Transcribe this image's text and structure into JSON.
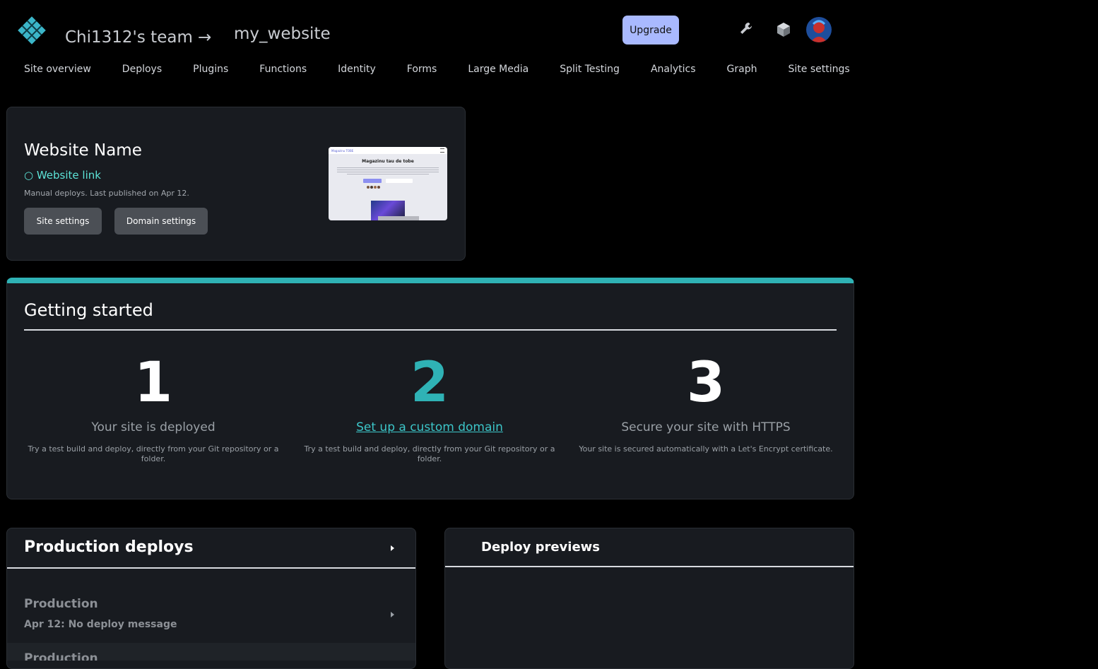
{
  "header": {
    "team": "Chi1312's team →",
    "site_name": "my_website",
    "upgrade_label": "Upgrade",
    "icons": [
      "netlify-logo-icon",
      "wrench-icon",
      "cube-icon",
      "user-avatar"
    ]
  },
  "nav": {
    "items": [
      "Site overview",
      "Deploys",
      "Plugins",
      "Functions",
      "Identity",
      "Forms",
      "Large Media",
      "Split Testing",
      "Analytics",
      "Graph",
      "Site settings"
    ]
  },
  "site_card": {
    "title": "Website Name",
    "link": "○ Website link",
    "meta": "Manual deploys. Last published on Apr 12.",
    "site_settings_label": "Site settings",
    "domain_settings_label": "Domain settings",
    "preview": {
      "brand": "Magazinu TOBE",
      "heading": "Magazinu tau de tobe"
    }
  },
  "getting_started": {
    "title": "Getting started",
    "steps": [
      {
        "num": "1",
        "title": "Your site is deployed",
        "desc": "Try a test build and deploy, directly from your Git repository or a folder."
      },
      {
        "num": "2",
        "title": "Set up a custom domain",
        "desc": "Try a test build and deploy, directly from your Git repository or a folder."
      },
      {
        "num": "3",
        "title": "Secure your site with HTTPS",
        "desc": "Your site is secured automatically with a Let's Encrypt certificate."
      }
    ]
  },
  "production": {
    "title": "Production deploys",
    "row1_label": "Production",
    "row1_msg": "Apr 12: No deploy message",
    "row2_label": "Production"
  },
  "previews": {
    "title": "Deploy previews"
  },
  "colors": {
    "accent_teal": "#2fb2b5",
    "link_green": "#5ce3d7",
    "upgrade_bg": "#a9b9ff",
    "card_bg": "#181b20"
  }
}
